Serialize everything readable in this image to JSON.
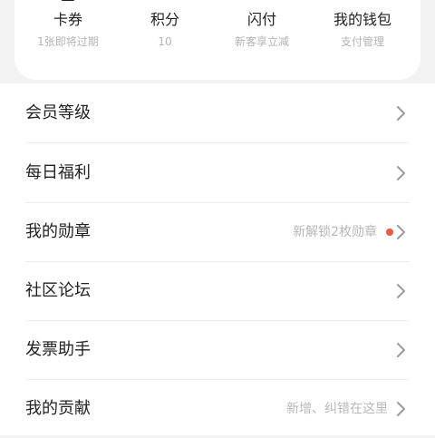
{
  "quick_links": [
    {
      "icon": "card-ticket-icon",
      "title": "卡券",
      "subtitle": "1张即将过期"
    },
    {
      "icon": "points-icon",
      "title": "积分",
      "subtitle": "10"
    },
    {
      "icon": "flash-pay-icon",
      "title": "闪付",
      "subtitle": "新客享立减"
    },
    {
      "icon": "wallet-icon",
      "title": "我的钱包",
      "subtitle": "支付管理"
    }
  ],
  "menu": [
    {
      "label": "会员等级",
      "hint": ""
    },
    {
      "label": "每日福利",
      "hint": ""
    },
    {
      "label": "我的勋章",
      "hint": "新解锁2枚勋章",
      "badge": true
    },
    {
      "label": "社区论坛",
      "hint": ""
    },
    {
      "label": "发票助手",
      "hint": ""
    },
    {
      "label": "我的贡献",
      "hint": "新增、纠错在这里"
    }
  ],
  "colors": {
    "badge_dot": "#f05a3f",
    "chevron": "#9a9a9a",
    "background": "#f3f3f3"
  }
}
